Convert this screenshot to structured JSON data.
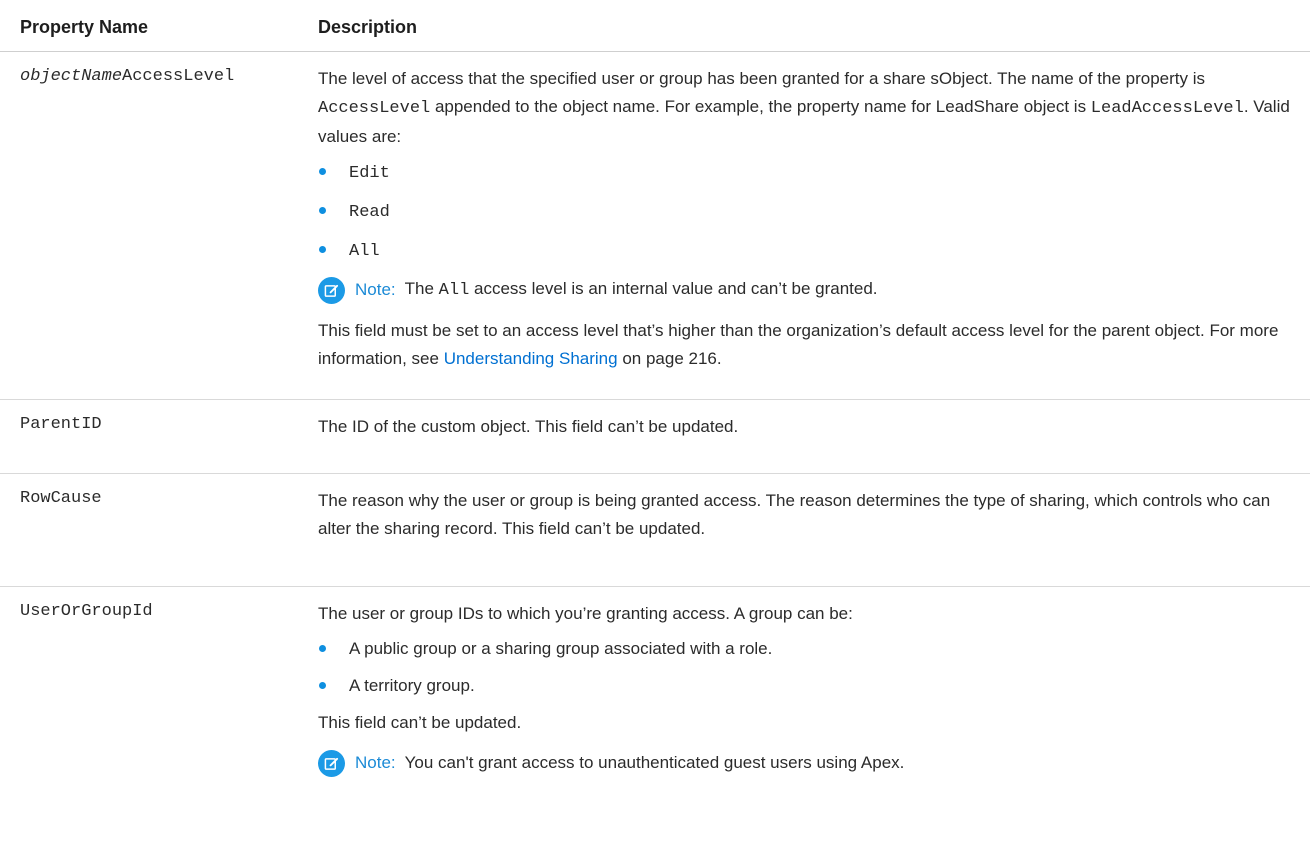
{
  "headers": {
    "col1": "Property Name",
    "col2": "Description"
  },
  "rows": {
    "access": {
      "name_italic": "objectName",
      "name_suffix": "AccessLevel",
      "p1_a": "The level of access that the specified user or group has been granted for a share sObject. The name of the property is ",
      "p1_code1": "AccessLevel",
      "p1_b": " appended to the object name. For example, the property name for LeadShare object is ",
      "p1_code2": "LeadAccessLevel",
      "p1_c": ". Valid values are:",
      "values": [
        "Edit",
        "Read",
        "All"
      ],
      "note_label": "Note:",
      "note_a": "The ",
      "note_code": "All",
      "note_b": " access level is an internal value and can’t be granted.",
      "p2_a": "This field must be set to an access level that’s higher than the organization’s default access level for the parent object. For more information, see ",
      "p2_link": "Understanding Sharing",
      "p2_b": " on page 216."
    },
    "parent": {
      "name": "ParentID",
      "desc": "The ID of the custom object. This field can’t be updated."
    },
    "rowcause": {
      "name": "RowCause",
      "desc": "The reason why the user or group is being granted access. The reason determines the type of sharing, which controls who can alter the sharing record. This field can’t be updated."
    },
    "usergroup": {
      "name": "UserOrGroupId",
      "intro": "The user or group IDs to which you’re granting access. A group can be:",
      "items": [
        "A public group or a sharing group associated with a role.",
        "A territory group."
      ],
      "after": "This field can’t be updated.",
      "note_label": "Note:",
      "note_text": "You can't grant access to unauthenticated guest users using Apex."
    }
  },
  "icon_color": "#1b9ae6",
  "link_color": "#0070d2"
}
